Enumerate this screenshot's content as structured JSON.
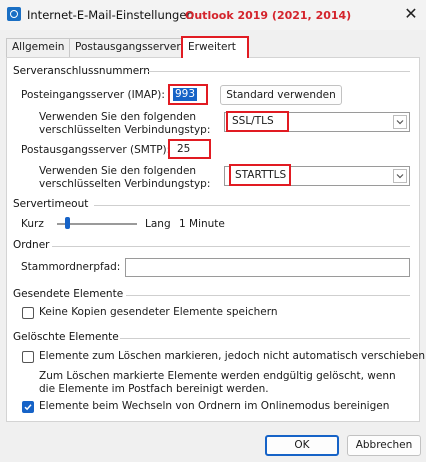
{
  "window": {
    "title": "Internet-E-Mail-Einstellungen",
    "annotation": "Outlook 2019 (2021, 2014)",
    "close_symbol": "✕"
  },
  "tabs": [
    {
      "label": "Allgemein",
      "active": false
    },
    {
      "label": "Postausgangsserver",
      "active": false
    },
    {
      "label": "Erweitert",
      "active": true
    }
  ],
  "server_ports": {
    "group_title": "Serveranschlussnummern",
    "incoming_label": "Posteingangsserver (IMAP):",
    "incoming_value": "993",
    "default_button": "Standard verwenden",
    "incoming_encryption_label": "Verwenden Sie den folgenden verschlüsselten Verbindungstyp:",
    "incoming_encryption_value": "SSL/TLS",
    "outgoing_label": "Postausgangsserver (SMTP):",
    "outgoing_value": "25",
    "outgoing_encryption_label": "Verwenden Sie den folgenden verschlüsselten Verbindungstyp:",
    "outgoing_encryption_value": "STARTTLS"
  },
  "timeout": {
    "group_title": "Servertimeout",
    "short_label": "Kurz",
    "long_label": "Lang",
    "value_text": "1 Minute",
    "slider_level": 0.1
  },
  "folder": {
    "group_title": "Ordner",
    "root_folder_label": "Stammordnerpfad:",
    "root_folder_value": ""
  },
  "sent_items": {
    "group_title": "Gesendete Elemente",
    "no_copies_label": "Keine Kopien gesendeter Elemente speichern",
    "no_copies_checked": false
  },
  "deleted_items": {
    "group_title": "Gelöschte Elemente",
    "mark_label": "Elemente zum Löschen markieren, jedoch nicht automatisch verschieben",
    "mark_checked": false,
    "mark_note": "Zum Löschen markierte Elemente werden endgültig gelöscht, wenn die Elemente im Postfach bereinigt werden.",
    "purge_label": "Elemente beim Wechseln von Ordnern im Onlinemodus bereinigen",
    "purge_checked": true
  },
  "footer": {
    "ok_label": "OK",
    "cancel_label": "Abbrechen"
  },
  "icons": {
    "app": "outlook-settings-icon",
    "close": "close-icon",
    "dropdown": "chevron-down-icon",
    "check": "checkmark-icon"
  },
  "colors": {
    "highlight_box": "#e11b22",
    "annotation_text": "#d4242c",
    "accent": "#1663c7"
  }
}
